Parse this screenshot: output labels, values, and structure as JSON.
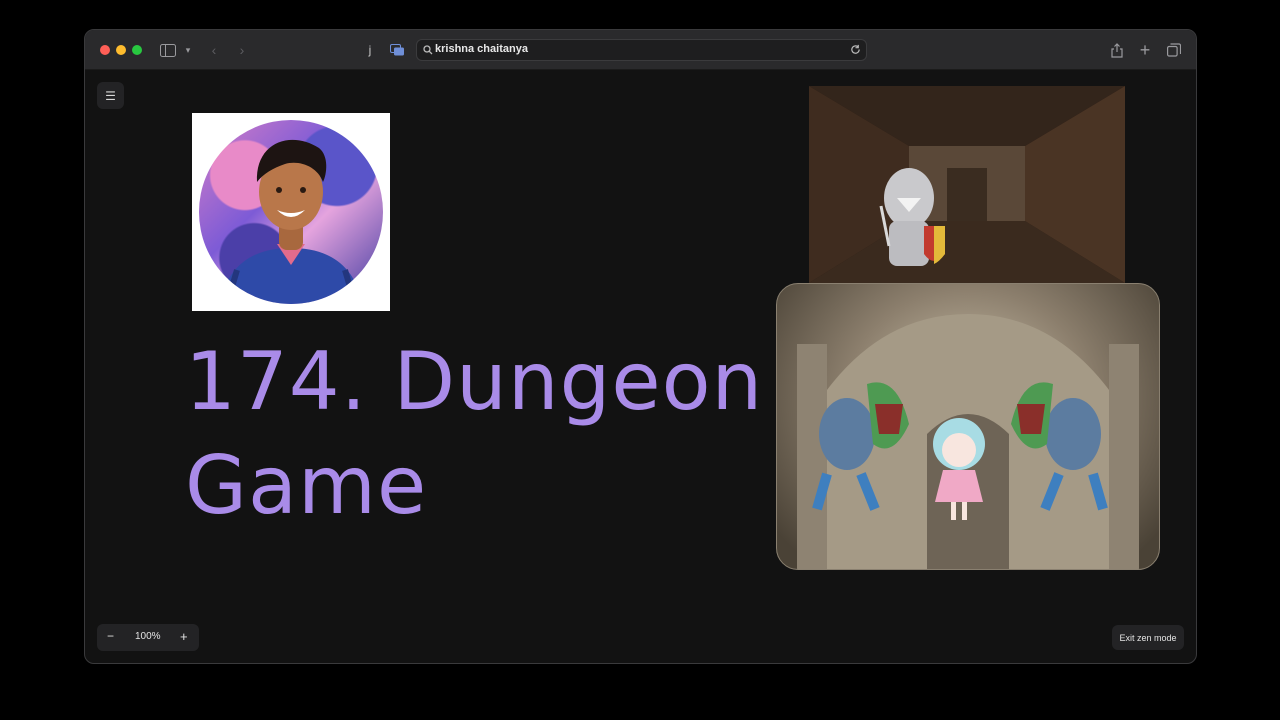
{
  "browser": {
    "address": "krishna chaitanya",
    "tab_label": "j"
  },
  "title": {
    "line1": "174. Dungeon",
    "line2": "Game"
  },
  "zoom": {
    "level": "100%",
    "minus": "−",
    "plus": "+"
  },
  "exit_label": "Exit zen mode",
  "colors": {
    "title": "#a98be8",
    "canvas": "#121212",
    "panel": "#232325"
  }
}
